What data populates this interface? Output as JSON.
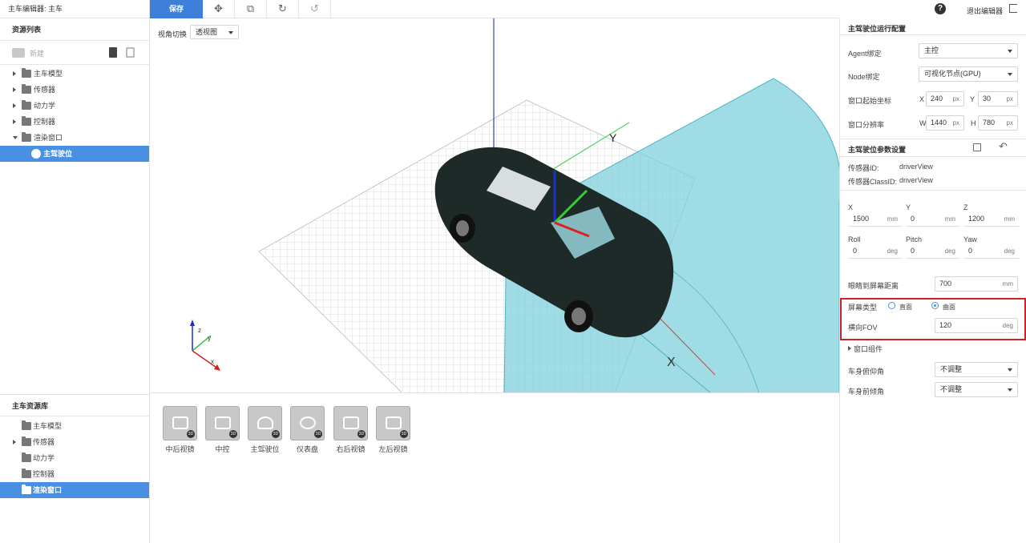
{
  "app": {
    "title": "主车编辑器: 主车"
  },
  "resources": {
    "title": "资源列表",
    "new_label": "新建",
    "items": [
      {
        "label": "主车模型",
        "expanded": false
      },
      {
        "label": "传感器",
        "expanded": false
      },
      {
        "label": "动力学",
        "expanded": false
      },
      {
        "label": "控制器",
        "expanded": false
      },
      {
        "label": "渲染窗口",
        "expanded": true
      },
      {
        "label": "主驾驶位",
        "selected": true
      }
    ]
  },
  "library": {
    "title": "主车资源库",
    "items": [
      {
        "label": "主车模型"
      },
      {
        "label": "传感器"
      },
      {
        "label": "动力学"
      },
      {
        "label": "控制器"
      },
      {
        "label": "渲染窗口",
        "selected": true
      }
    ]
  },
  "toolbar": {
    "save_label": "保存",
    "tools": [
      "move-icon",
      "transform-icon",
      "rotate-icon",
      "reset-icon"
    ]
  },
  "header": {
    "exit_label": "退出编辑器",
    "help_glyph": "?"
  },
  "viewport": {
    "view_label": "视角切换",
    "view_value": "透视图",
    "axis_y": "Y",
    "axis_x": "X",
    "gizmo_z": "z",
    "gizmo_y": "y",
    "gizmo_x": "x"
  },
  "components": [
    {
      "label": "中后视镜",
      "badge": "3D"
    },
    {
      "label": "中控",
      "badge": "3D"
    },
    {
      "label": "主驾驶位",
      "badge": "3D"
    },
    {
      "label": "仪表盘",
      "badge": "3D"
    },
    {
      "label": "右后视镜",
      "badge": "3D"
    },
    {
      "label": "左后视镜",
      "badge": "3D"
    }
  ],
  "panel": {
    "run_config_title": "主驾驶位运行配置",
    "agent_label": "Agent绑定",
    "agent_value": "主控",
    "node_label": "Node绑定",
    "node_value": "可视化节点(GPU)",
    "origin_label": "窗口起始坐标",
    "origin_x_label": "X",
    "origin_x": "240",
    "origin_y_label": "Y",
    "origin_y": "30",
    "res_label": "窗口分辨率",
    "res_w_label": "W",
    "res_w": "1440",
    "res_h_label": "H",
    "res_h": "780",
    "unit_px": "px",
    "params_title": "主驾驶位参数设置",
    "sensor_id_label": "传感器ID:",
    "sensor_id": "driverView",
    "sensor_class_label": "传感器ClassID:",
    "sensor_class": "driverView",
    "x_label": "X",
    "x_value": "1500",
    "y_label": "Y",
    "y_value": "0",
    "z_label": "Z",
    "z_value": "1200",
    "unit_mm": "mm",
    "roll_label": "Roll",
    "roll_value": "0",
    "pitch_label": "Pitch",
    "pitch_value": "0",
    "yaw_label": "Yaw",
    "yaw_value": "0",
    "unit_deg": "deg",
    "eye_dist_label": "眼睛到屏幕距离",
    "eye_dist_value": "700",
    "screen_type_label": "屏幕类型",
    "screen_flat": "直面",
    "screen_curved": "曲面",
    "screen_type_selected": "曲面",
    "fov_label": "横向FOV",
    "fov_value": "120",
    "window_group_label": "窗口组件",
    "pitch_body_label": "车身俯仰角",
    "pitch_body_value": "不调整",
    "tilt_body_label": "车身前倾角",
    "tilt_body_value": "不调整"
  },
  "colors": {
    "accent": "#4a90e2",
    "save": "#3d7fd9",
    "highlight": "#d0202a",
    "frustum": "#7fd0dc"
  }
}
